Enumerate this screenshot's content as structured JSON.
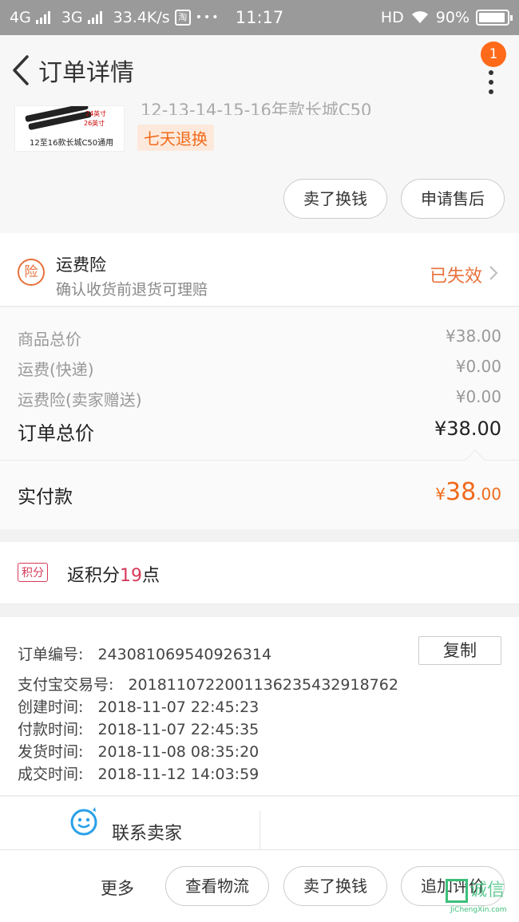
{
  "status_bar": {
    "network1": "4G",
    "network2": "3G",
    "speed": "33.4K/s",
    "taobao_glyph": "淘",
    "dots": "•••",
    "time": "11:17",
    "hd": "HD",
    "battery": "90%"
  },
  "header": {
    "title": "订单详情",
    "badge_count": "1"
  },
  "product": {
    "thumb_label_1": "24英寸",
    "thumb_label_2": "26英寸",
    "thumb_caption": "12至16款长城C50通用",
    "title_partial": "12-13-14-15-16年款长城C50",
    "tag": "七天退换",
    "btn_sell": "卖了换钱",
    "btn_aftersale": "申请售后"
  },
  "insurance": {
    "icon_char": "险",
    "title": "运费险",
    "subtitle": "确认收货前退货可理赔",
    "status": "已失效"
  },
  "prices": {
    "rows": [
      {
        "label": "商品总价",
        "value": "¥38.00"
      },
      {
        "label": "运费(快递)",
        "value": "¥0.00"
      },
      {
        "label": "运费险(卖家赠送)",
        "value": "¥0.00"
      }
    ],
    "total_label": "订单总价",
    "total_value": "¥38.00",
    "paid_label": "实付款",
    "paid_currency": "¥",
    "paid_int": "38",
    "paid_dec": ".00"
  },
  "points": {
    "icon_text": "积分",
    "prefix": "返积分",
    "number": "19",
    "suffix": "点"
  },
  "order_info": {
    "order_no_label": "订单编号:",
    "order_no": "243081069540926314",
    "copy_button": "复制",
    "alipay_label": "支付宝交易号:",
    "alipay_no": "2018110722001136235432918762",
    "rows": [
      {
        "label": "创建时间:",
        "value": "2018-11-07 22:45:23"
      },
      {
        "label": "付款时间:",
        "value": "2018-11-07 22:45:35"
      },
      {
        "label": "发货时间:",
        "value": "2018-11-08 08:35:20"
      },
      {
        "label": "成交时间:",
        "value": "2018-11-12 14:03:59"
      }
    ]
  },
  "contact": {
    "label": "联系卖家"
  },
  "bottom_bar": {
    "more": "更多",
    "btn_logistics": "查看物流",
    "btn_sell": "卖了换钱",
    "btn_review": "追加评价"
  },
  "watermark": {
    "text": "诚信",
    "sub": "JiChengXin.com"
  },
  "colors": {
    "accent_orange": "#f06a1a",
    "points_red": "#d63a5a",
    "contact_blue": "#2aa0e8"
  }
}
